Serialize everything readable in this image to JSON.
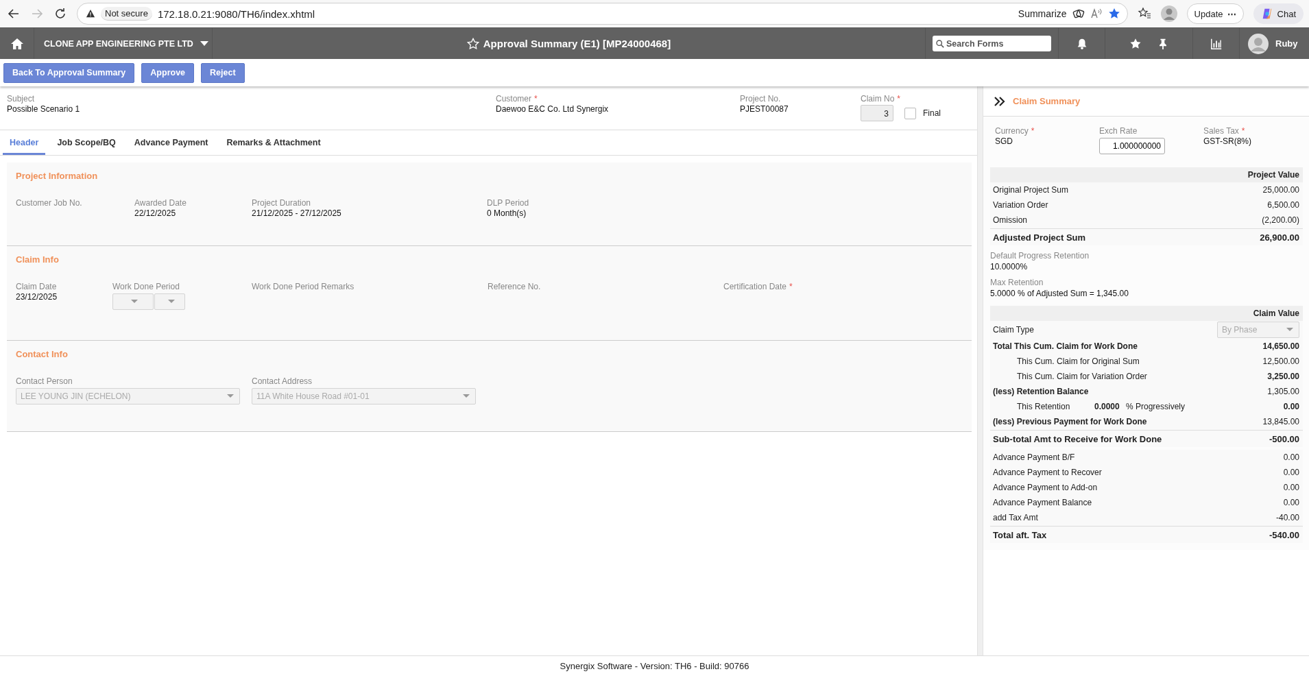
{
  "browser": {
    "security": "Not secure",
    "url": "172.18.0.21:9080/TH6/index.xhtml",
    "summarize": "Summarize",
    "update": "Update",
    "update_more": "⋯",
    "chat": "Chat"
  },
  "app_header": {
    "company": "CLONE APP ENGINEERING PTE LTD",
    "title": "Approval Summary (E1) [MP24000468]",
    "search": {
      "placeholder": "Search Forms"
    },
    "user": "Ruby"
  },
  "toolbar": {
    "buttons": [
      "Back To Approval Summary",
      "Approve",
      "Reject"
    ]
  },
  "top_fields": [
    {
      "kind": "text",
      "label": "Subject",
      "value": "Possible Scenario 1"
    },
    {
      "kind": "text",
      "label": "Customer",
      "required_mark": "*",
      "value": "Daewoo E&C Co. Ltd Synergix"
    },
    {
      "kind": "text",
      "label": "Project No.",
      "value": "PJEST00087"
    },
    {
      "kind": "claim_no",
      "label": "Claim No",
      "required_mark": "*",
      "value": "3",
      "checkbox": {
        "label": "Final",
        "checked": false
      }
    }
  ],
  "tabs": [
    {
      "label": "Header",
      "selected": true
    },
    {
      "label": "Job Scope/BQ",
      "selected": false
    },
    {
      "label": "Advance Payment",
      "selected": false
    },
    {
      "label": "Remarks & Attachment",
      "selected": false
    }
  ],
  "sections": [
    {
      "title": "Project Information",
      "fields": [
        {
          "kind": "text",
          "label": "Customer Job No."
        },
        {
          "kind": "text",
          "label": "Awarded Date",
          "value": "22/12/2025"
        },
        {
          "kind": "text",
          "label": "Project Duration",
          "value": "21/12/2025 - 27/12/2025"
        },
        {
          "kind": "text",
          "label": "DLP Period",
          "value": "0 Month(s)"
        }
      ]
    },
    {
      "title": "Claim Info",
      "fields": [
        {
          "kind": "text",
          "label": "Claim Date",
          "value": "23/12/2025"
        },
        {
          "kind": "select_pair",
          "label": "Work Done Period",
          "disabled": true
        },
        {
          "kind": "text",
          "label": "Work Done Period Remarks"
        },
        {
          "kind": "text",
          "label": "Reference No."
        },
        {
          "kind": "text",
          "label": "Certification Date",
          "required_mark": "*"
        }
      ]
    },
    {
      "title": "Contact Info",
      "fields": [
        {
          "kind": "select",
          "label": "Contact Person",
          "value": "LEE YOUNG JIN (ECHELON)",
          "disabled": true
        },
        {
          "kind": "select",
          "label": "Contact Address",
          "value": "11A White House Road #01-01",
          "disabled": true
        }
      ]
    }
  ],
  "claim_summary": {
    "title": "Claim Summary",
    "fields": [
      {
        "kind": "text",
        "label": "Currency",
        "required_mark": "*",
        "value": "SGD"
      },
      {
        "kind": "input",
        "label": "Exch Rate",
        "value": "1.000000000"
      },
      {
        "kind": "text",
        "label": "Sales Tax",
        "required_mark": "*",
        "value": "GST-SR(8%)"
      }
    ],
    "project_value": {
      "heading": "Project Value",
      "rows": [
        {
          "kind": "plain",
          "label": "Original Project Sum",
          "value": "25,000.00"
        },
        {
          "kind": "plain",
          "label": "Variation Order",
          "value": "6,500.00"
        },
        {
          "kind": "plain",
          "label": "Omission",
          "value": "(2,200.00)"
        },
        {
          "kind": "total",
          "label": "Adjusted Project Sum",
          "value": "26,900.00"
        }
      ]
    },
    "info": [
      {
        "label": "Default Progress Retention",
        "value": "10.0000%"
      },
      {
        "label": "Max Retention",
        "value": "5.0000 % of Adjusted Sum = 1,345.00"
      }
    ],
    "claim_value": {
      "heading": "Claim Value",
      "rows": [
        {
          "kind": "select",
          "label": "Claim Type",
          "value": "By Phase",
          "disabled": true
        },
        {
          "kind": "bold",
          "label": "Total This Cum. Claim for Work Done",
          "value": "14,650.00",
          "value_bold": true
        },
        {
          "kind": "indent",
          "label": "This Cum. Claim for Original Sum",
          "value": "12,500.00",
          "value_bold": false
        },
        {
          "kind": "indent",
          "label": "This Cum. Claim for Variation Order",
          "value": "3,250.00",
          "value_bold": true
        },
        {
          "kind": "bold",
          "label": "(less) Retention Balance",
          "value": "1,305.00",
          "value_bold": false
        },
        {
          "kind": "retention",
          "label": "This Retention",
          "rate": "0.0000",
          "unit": "% Progressively",
          "value": "0.00",
          "value_bold": true
        },
        {
          "kind": "bold",
          "label": "(less) Previous Payment for Work Done",
          "value": "13,845.00",
          "value_bold": false
        },
        {
          "kind": "total",
          "label": "Sub-total Amt to Receive for Work Done",
          "value": "-500.00"
        }
      ]
    },
    "advance": {
      "rows": [
        {
          "kind": "plain",
          "label": "Advance Payment B/F",
          "value": "0.00"
        },
        {
          "kind": "plain",
          "label": "Advance Payment to Recover",
          "value": "0.00"
        },
        {
          "kind": "plain",
          "label": "Advance Payment to Add-on",
          "value": "0.00"
        },
        {
          "kind": "plain",
          "label": "Advance Payment Balance",
          "value": "0.00"
        },
        {
          "kind": "plain",
          "label": "add Tax Amt",
          "value": "-40.00"
        },
        {
          "kind": "total",
          "label": "Total aft. Tax",
          "value": "-540.00"
        }
      ]
    }
  },
  "footer": "Synergix Software - Version: TH6 - Build: 90766"
}
